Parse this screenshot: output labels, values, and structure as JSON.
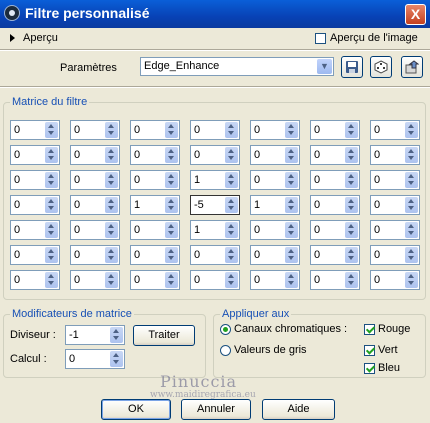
{
  "window": {
    "title": "Filtre personnalisé",
    "close_label": "X"
  },
  "preview": {
    "label": "Aperçu",
    "image_preview_label": "Aperçu de l'image",
    "image_preview_checked": false
  },
  "params": {
    "label": "Paramètres",
    "preset": "Edge_Enhance"
  },
  "matrix": {
    "title": "Matrice du filtre",
    "rows": [
      [
        "0",
        "0",
        "0",
        "0",
        "0",
        "0",
        "0"
      ],
      [
        "0",
        "0",
        "0",
        "0",
        "0",
        "0",
        "0"
      ],
      [
        "0",
        "0",
        "0",
        "1",
        "0",
        "0",
        "0"
      ],
      [
        "0",
        "0",
        "1",
        "-5",
        "1",
        "0",
        "0"
      ],
      [
        "0",
        "0",
        "0",
        "1",
        "0",
        "0",
        "0"
      ],
      [
        "0",
        "0",
        "0",
        "0",
        "0",
        "0",
        "0"
      ],
      [
        "0",
        "0",
        "0",
        "0",
        "0",
        "0",
        "0"
      ]
    ]
  },
  "modifiers": {
    "title": "Modificateurs de matrice",
    "divisor_label": "Diviseur :",
    "divisor_value": "-1",
    "calc_label": "Calcul :",
    "calc_value": "0",
    "process_button": "Traiter"
  },
  "apply": {
    "title": "Appliquer aux",
    "chromatic_label": "Canaux chromatiques :",
    "gray_label": "Valeurs de gris",
    "mode": "chromatic",
    "channels": [
      {
        "label": "Rouge",
        "checked": true
      },
      {
        "label": "Vert",
        "checked": true
      },
      {
        "label": "Bleu",
        "checked": true
      }
    ]
  },
  "buttons": {
    "ok": "OK",
    "cancel": "Annuler",
    "help": "Aide"
  },
  "watermark": {
    "name": "Pinuccia",
    "url": "www.maidiregrafica.eu"
  }
}
